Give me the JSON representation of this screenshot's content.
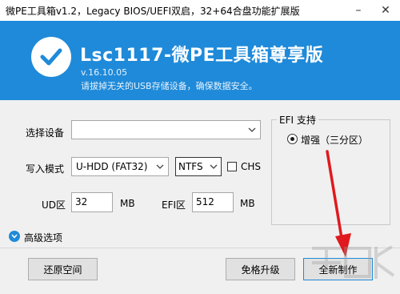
{
  "window": {
    "title": "微PE工具箱v1.2，Legacy BIOS/UEFI双启，32+64合盘功能扩展版",
    "controls": {
      "minimize": "–",
      "close": "✕"
    }
  },
  "header": {
    "title": "Lsc1117-微PE工具箱尊享版",
    "version": "v.16.10.05",
    "warning": "请拔掉无关的USB存储设备，确保数据安全。",
    "background_color": "#1f8ad9"
  },
  "form": {
    "device_label": "选择设备",
    "device_value": "",
    "write_mode_label": "写入模式",
    "write_mode_value": "U-HDD (FAT32)",
    "filesystem_value": "NTFS",
    "chs_label": "CHS",
    "chs_checked": false,
    "ud_label": "UD区",
    "ud_value": "32",
    "ud_unit": "MB",
    "efi_label": "EFI区",
    "efi_value": "512",
    "efi_unit": "MB"
  },
  "efi_support": {
    "group_label": "EFI 支持",
    "option_label": "增强（三分区）",
    "selected": true
  },
  "advanced": {
    "label": "高级选项",
    "icon": "chevron-down-icon"
  },
  "buttons": {
    "restore": "还原空间",
    "upgrade": "免格升级",
    "create": "全新制作"
  },
  "annotation": {
    "arrow_color": "#e0191e"
  }
}
